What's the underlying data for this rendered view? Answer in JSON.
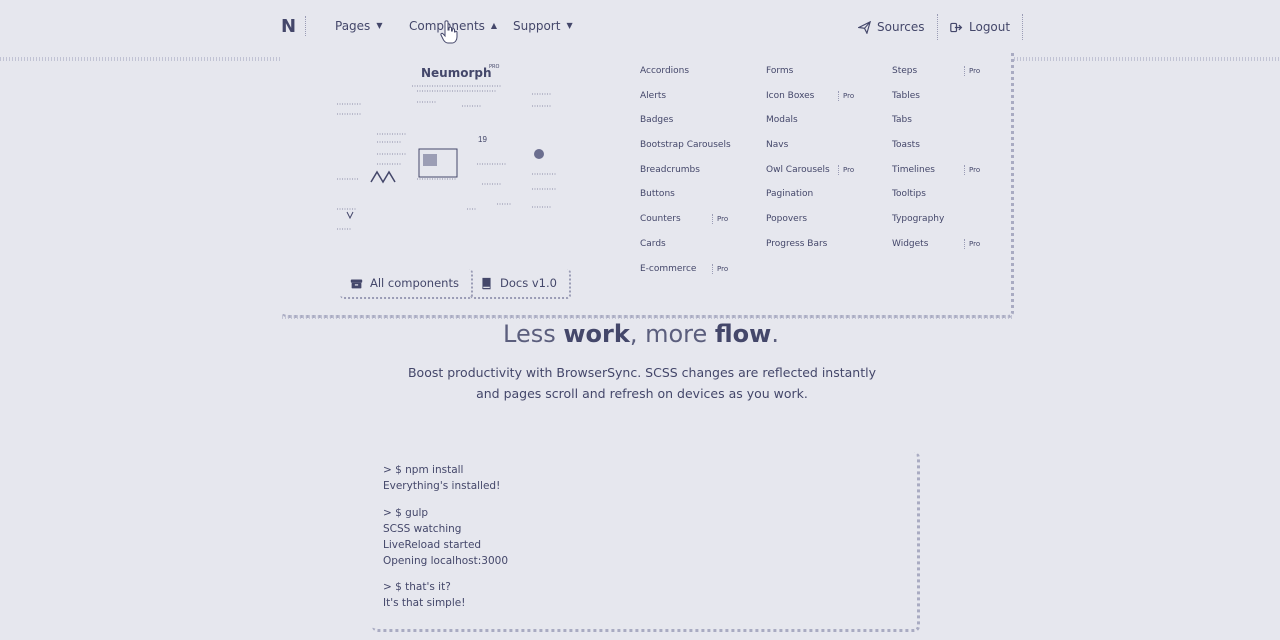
{
  "navbar": {
    "brand": "N",
    "items": [
      {
        "label": "Pages"
      },
      {
        "label": "Components"
      },
      {
        "label": "Support"
      }
    ],
    "sources_label": "Sources",
    "logout_label": "Logout"
  },
  "dropdown": {
    "preview_title": "Neumorph",
    "preview_badge": "PRO",
    "all_components_label": "All components",
    "docs_label": "Docs v1.0",
    "columns": [
      [
        {
          "label": "Accordions",
          "pro": ""
        },
        {
          "label": "Alerts",
          "pro": ""
        },
        {
          "label": "Badges",
          "pro": ""
        },
        {
          "label": "Bootstrap Carousels",
          "pro": ""
        },
        {
          "label": "Breadcrumbs",
          "pro": ""
        },
        {
          "label": "Buttons",
          "pro": ""
        },
        {
          "label": "Counters",
          "pro": "Pro"
        },
        {
          "label": "Cards",
          "pro": ""
        },
        {
          "label": "E-commerce",
          "pro": "Pro"
        }
      ],
      [
        {
          "label": "Forms",
          "pro": ""
        },
        {
          "label": "Icon Boxes",
          "pro": "Pro"
        },
        {
          "label": "Modals",
          "pro": ""
        },
        {
          "label": "Navs",
          "pro": ""
        },
        {
          "label": "Owl Carousels",
          "pro": "Pro"
        },
        {
          "label": "Pagination",
          "pro": ""
        },
        {
          "label": "Popovers",
          "pro": ""
        },
        {
          "label": "Progress Bars",
          "pro": ""
        }
      ],
      [
        {
          "label": "Steps",
          "pro": "Pro"
        },
        {
          "label": "Tables",
          "pro": ""
        },
        {
          "label": "Tabs",
          "pro": ""
        },
        {
          "label": "Toasts",
          "pro": ""
        },
        {
          "label": "Timelines",
          "pro": "Pro"
        },
        {
          "label": "Tooltips",
          "pro": ""
        },
        {
          "label": "Typography",
          "pro": ""
        },
        {
          "label": "Widgets",
          "pro": "Pro"
        }
      ]
    ]
  },
  "hero": {
    "title_part1": "Less ",
    "title_bold1": "work",
    "title_part2": ", more ",
    "title_bold2": "flow",
    "title_part3": ".",
    "text": "Boost productivity with BrowserSync. SCSS changes are reflected instantly and pages scroll and refresh on devices as you work."
  },
  "terminal": {
    "lines": [
      "> $ npm install",
      "Everything's installed!",
      "> $ gulp",
      "SCSS watching",
      "LiveReload started",
      "Opening localhost:3000",
      "> $ that's it?",
      "It's that simple!"
    ]
  },
  "colors": {
    "background": "#e6e7ee",
    "text": "#44476a"
  },
  "icons": {
    "sources": "paper-plane-icon",
    "logout": "sign-out-icon",
    "all_components": "archive-icon",
    "docs": "book-icon"
  }
}
